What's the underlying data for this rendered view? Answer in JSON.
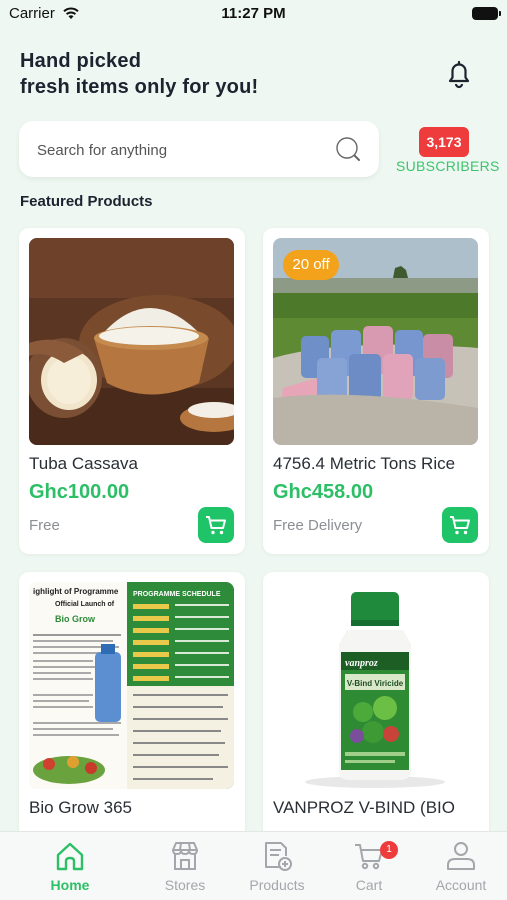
{
  "status_bar": {
    "carrier": "Carrier",
    "time": "11:27 PM"
  },
  "header": {
    "line1": "Hand picked",
    "line2": "fresh items only for you!"
  },
  "search": {
    "placeholder": "Search for anything"
  },
  "subscribers": {
    "count": "3,173",
    "label": "SUBSCRIBERS"
  },
  "featured": {
    "title": "Featured Products",
    "products": [
      {
        "name": "Tuba Cassava",
        "price": "Ghc100.00",
        "shipping": "Free"
      },
      {
        "name": "4756.4 Metric Tons Rice",
        "price": "Ghc458.00",
        "shipping": "Free Delivery",
        "discount": "20 off"
      },
      {
        "name": "Bio Grow 365"
      },
      {
        "name": "VANPROZ V-BIND (BIO",
        "image_text": {
          "brand": "vanproz",
          "label": "V-Bind Viricide"
        }
      }
    ]
  },
  "poster": {
    "title_left": "ighlight of Programme",
    "subtitle_left": "Official Launch of",
    "brand": "Bio Grow",
    "title_right": "PROGRAMME SCHEDULE"
  },
  "tabs": [
    {
      "label": "Home",
      "icon": "home-icon",
      "active": true
    },
    {
      "label": "Stores",
      "icon": "store-icon"
    },
    {
      "label": "Products",
      "icon": "products-icon"
    },
    {
      "label": "Cart",
      "icon": "cart-icon",
      "badge": "1"
    },
    {
      "label": "Account",
      "icon": "account-icon"
    }
  ],
  "colors": {
    "accent_green": "#2dbf66",
    "badge_red": "#ee3b3b",
    "discount_orange": "#f2a21b",
    "background": "#eef7f1"
  }
}
